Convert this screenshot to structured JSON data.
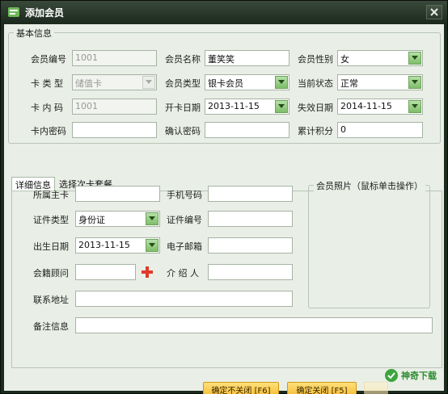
{
  "window": {
    "title": "添加会员"
  },
  "basic": {
    "group_title": "基本信息",
    "member_no": {
      "label": "会员编号",
      "value": "1001"
    },
    "member_name": {
      "label": "会员名称",
      "value": "董笑笑"
    },
    "gender": {
      "label": "会员性别",
      "value": "女"
    },
    "card_type": {
      "label": "卡 类 型",
      "value": "储值卡"
    },
    "member_type": {
      "label": "会员类型",
      "value": "银卡会员"
    },
    "status": {
      "label": "当前状态",
      "value": "正常"
    },
    "card_no": {
      "label": "卡 内 码",
      "value": "1001"
    },
    "open_date": {
      "label": "开卡日期",
      "value": "2013-11-15"
    },
    "expire_date": {
      "label": "失效日期",
      "value": "2014-11-15"
    },
    "card_pwd": {
      "label": "卡内密码",
      "value": ""
    },
    "confirm_pwd": {
      "label": "确认密码",
      "value": ""
    },
    "points": {
      "label": "累计积分",
      "value": "0"
    }
  },
  "tabs": {
    "details": "详细信息",
    "package": "选择次卡套餐"
  },
  "details": {
    "main_card": {
      "label": "所属主卡",
      "value": ""
    },
    "phone": {
      "label": "手机号码",
      "value": ""
    },
    "id_type": {
      "label": "证件类型",
      "value": "身份证"
    },
    "id_no": {
      "label": "证件编号",
      "value": ""
    },
    "birthday": {
      "label": "出生日期",
      "value": "2013-11-15"
    },
    "email": {
      "label": "电子邮箱",
      "value": ""
    },
    "consultant": {
      "label": "会籍顾问",
      "value": ""
    },
    "referrer": {
      "label": "介 绍 人",
      "value": ""
    },
    "address": {
      "label": "联系地址",
      "value": ""
    },
    "remark": {
      "label": "备注信息",
      "value": ""
    },
    "photo_title": "会员照片（鼠标单击操作）"
  },
  "buttons": {
    "confirm_keep": "确定不关闭 [F6]",
    "confirm_close": "确定关闭 [F5]"
  },
  "watermark": {
    "text": "神奇下载"
  },
  "icons": [
    "app-icon",
    "close-icon",
    "dropdown-arrow-icon",
    "plus-icon",
    "watermark-logo-icon"
  ],
  "colors": {
    "titlebar": "#1d2a1e",
    "client_bg": "#e9efe6",
    "button_gradient_top": "#ffe07a",
    "button_gradient_bottom": "#f2b01e",
    "plus": "#e03a2a"
  }
}
